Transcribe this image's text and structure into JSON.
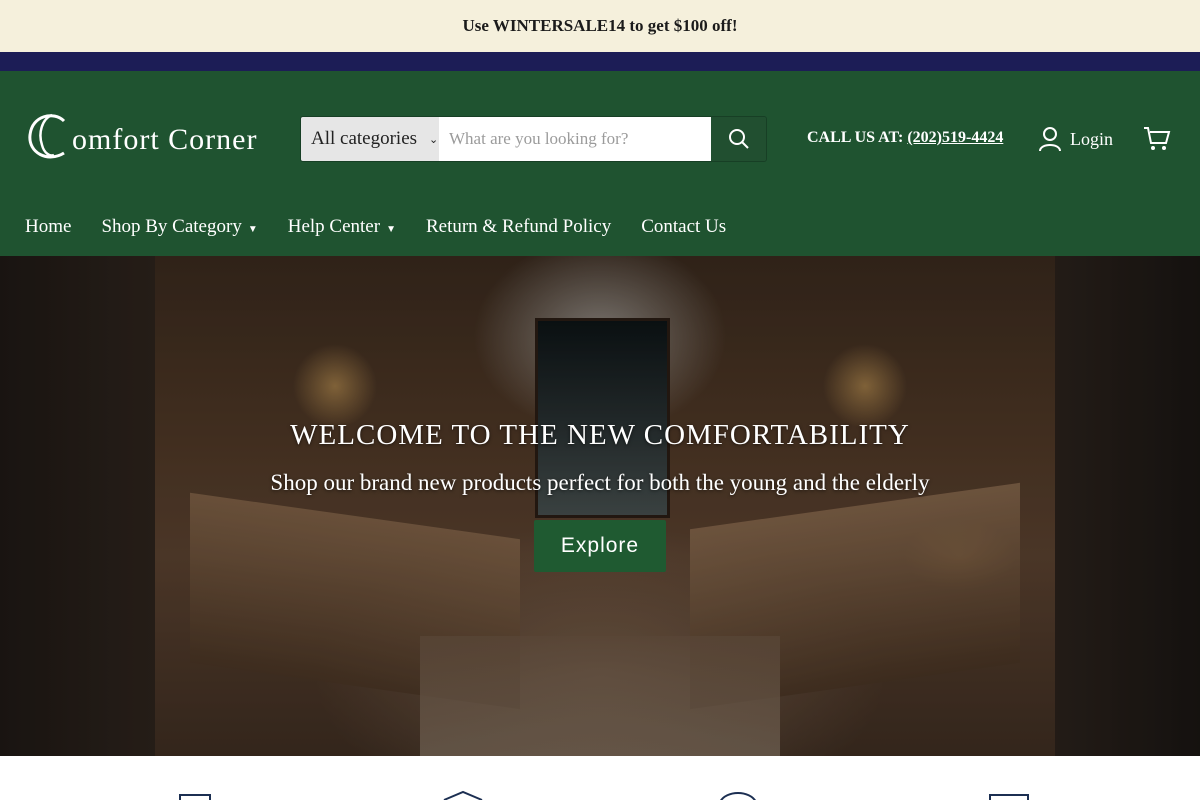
{
  "announcement": {
    "text": "Use WINTERSALE14 to get $100 off!"
  },
  "header": {
    "logo_text": "omfort Corner",
    "search": {
      "category_label": "All categories",
      "placeholder": "What are you looking for?"
    },
    "call": {
      "label": "CALL US AT:",
      "phone": "(202)519-4424"
    },
    "login_label": "Login"
  },
  "nav": {
    "items": [
      {
        "label": "Home"
      },
      {
        "label": "Shop By Category"
      },
      {
        "label": "Help Center"
      },
      {
        "label": "Return & Refund Policy"
      },
      {
        "label": "Contact Us"
      }
    ]
  },
  "hero": {
    "title": "WELCOME TO THE NEW COMFORTABILITY",
    "subtitle": "Shop our brand new products perfect for both the young and the elderly",
    "button_label": "Explore"
  },
  "colors": {
    "announcement_bg": "#f5f0dc",
    "navy_band": "#1c1d56",
    "header_green": "#1f5330",
    "button_green": "#1f5a31"
  },
  "icons": [
    "search-icon",
    "user-icon",
    "cart-icon",
    "chevron-down-icon",
    "feature-box-icon",
    "feature-package-icon",
    "feature-circle-icon",
    "feature-monitor-icon"
  ]
}
